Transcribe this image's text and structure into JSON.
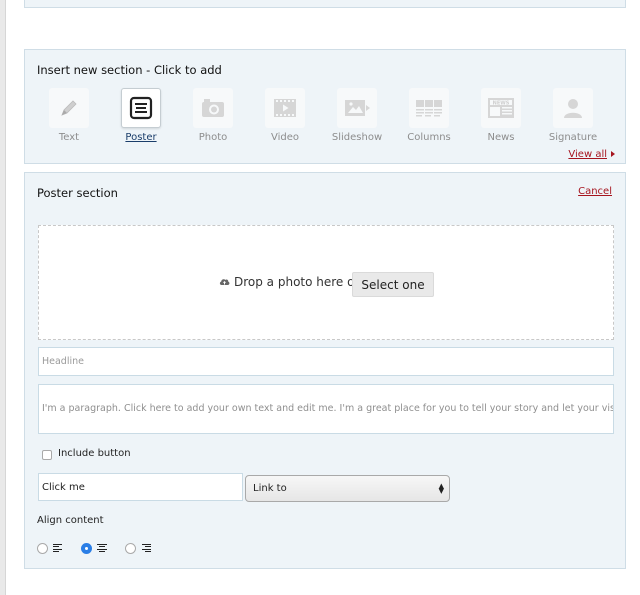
{
  "insert_panel": {
    "title": "Insert new section - Click to add",
    "sections": [
      {
        "label": "Text",
        "icon": "pencil-icon",
        "active": false
      },
      {
        "label": "Poster",
        "icon": "poster-icon",
        "active": true
      },
      {
        "label": "Photo",
        "icon": "camera-icon",
        "active": false
      },
      {
        "label": "Video",
        "icon": "film-icon",
        "active": false
      },
      {
        "label": "Slideshow",
        "icon": "slideshow-icon",
        "active": false
      },
      {
        "label": "Columns",
        "icon": "columns-icon",
        "active": false
      },
      {
        "label": "News",
        "icon": "newspaper-icon",
        "active": false
      },
      {
        "label": "Signature",
        "icon": "person-icon",
        "active": false
      }
    ],
    "view_all": "View all"
  },
  "poster_panel": {
    "title": "Poster section",
    "cancel": "Cancel",
    "dropzone": {
      "text": "Drop a photo here or",
      "button": "Select one"
    },
    "headline_placeholder": "Headline",
    "paragraph_text": "I'm a paragraph. Click here to add your own text and edit me. I'm a great place for you to tell your story and let your visitors kno",
    "include_button_label": "Include button",
    "include_button_checked": false,
    "button_text_value": "Click me",
    "link_select_value": "Link to",
    "align_label": "Align content",
    "align_options": [
      "left",
      "center",
      "right"
    ],
    "align_selected": "center"
  },
  "colors": {
    "panel_bg": "#eef4f8",
    "accent_link": "#a6141e",
    "radio_selected": "#2a7ee6"
  }
}
